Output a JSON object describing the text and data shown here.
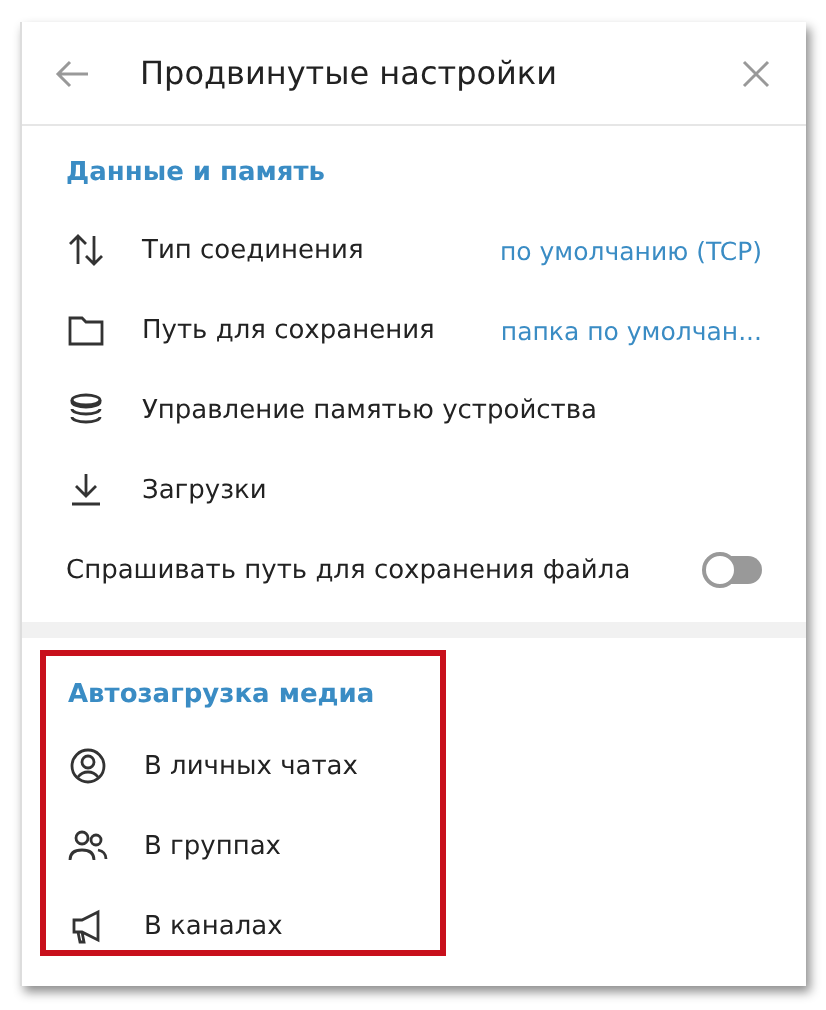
{
  "header": {
    "title": "Продвинутые настройки"
  },
  "sections": [
    {
      "title": "Данные и память",
      "highlighted": false,
      "rows": [
        {
          "kind": "link",
          "label": "Тип соединения",
          "value": "по умолчанию (TCP)"
        },
        {
          "kind": "link",
          "label": "Путь для сохранения",
          "value": "папка по умолчан..."
        },
        {
          "kind": "link",
          "label": "Управление памятью устройства"
        },
        {
          "kind": "link",
          "label": "Загрузки"
        },
        {
          "kind": "toggle",
          "label": "Спрашивать путь для сохранения файла",
          "on": false
        }
      ]
    },
    {
      "title": "Автозагрузка медиа",
      "highlighted": true,
      "rows": [
        {
          "kind": "link",
          "label": "В личных чатах"
        },
        {
          "kind": "link",
          "label": "В группах"
        },
        {
          "kind": "link",
          "label": "В каналах"
        }
      ]
    }
  ]
}
